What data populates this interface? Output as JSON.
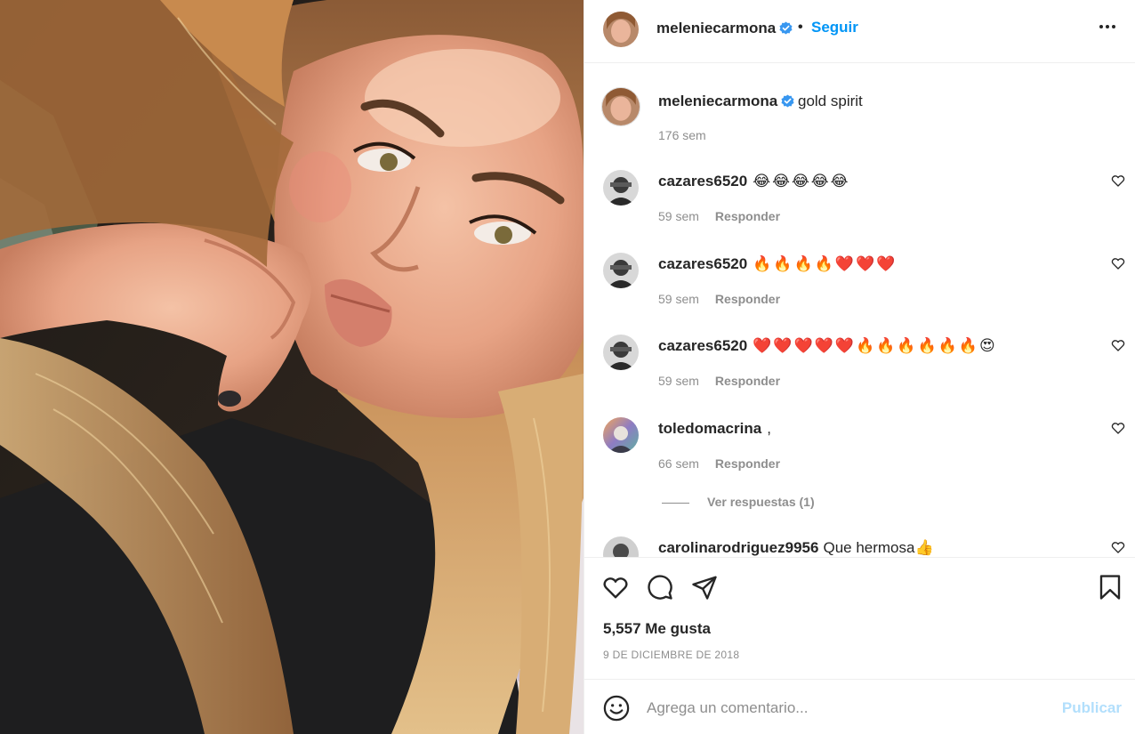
{
  "post": {
    "username": "meleniecarmona",
    "follow_label": "Seguir",
    "separator": "•",
    "caption": "gold spirit",
    "caption_time": "176 sem",
    "likes": "5,557 Me gusta",
    "date": "9 DE DICIEMBRE DE 2018"
  },
  "comments": [
    {
      "username": "cazares6520",
      "text": "😂😂😂😂😂",
      "time": "59 sem",
      "reply_label": "Responder"
    },
    {
      "username": "cazares6520",
      "text": "🔥🔥🔥🔥❤️❤️❤️",
      "time": "59 sem",
      "reply_label": "Responder"
    },
    {
      "username": "cazares6520",
      "text": "❤️❤️❤️❤️❤️🔥🔥🔥🔥🔥🔥😍",
      "time": "59 sem",
      "reply_label": "Responder"
    },
    {
      "username": "toledomacrina",
      "text": ",",
      "time": "66 sem",
      "reply_label": "Responder"
    },
    {
      "username": "carolinarodriguez9956",
      "text": "Que hermosa👍"
    }
  ],
  "view_replies_label": "Ver respuestas (1)",
  "composer": {
    "placeholder": "Agrega un comentario...",
    "post_label": "Publicar"
  },
  "icons": {
    "verified": "verified-badge-icon",
    "more": "more-options-icon",
    "like": "heart-icon",
    "comment": "comment-icon",
    "share": "paper-plane-icon",
    "save": "bookmark-icon",
    "emoji": "smiley-icon"
  },
  "colors": {
    "accent": "#0095f6",
    "post_disabled": "#b2dffc",
    "muted": "#8e8e8e",
    "text": "#262626",
    "divider": "#efefef"
  }
}
